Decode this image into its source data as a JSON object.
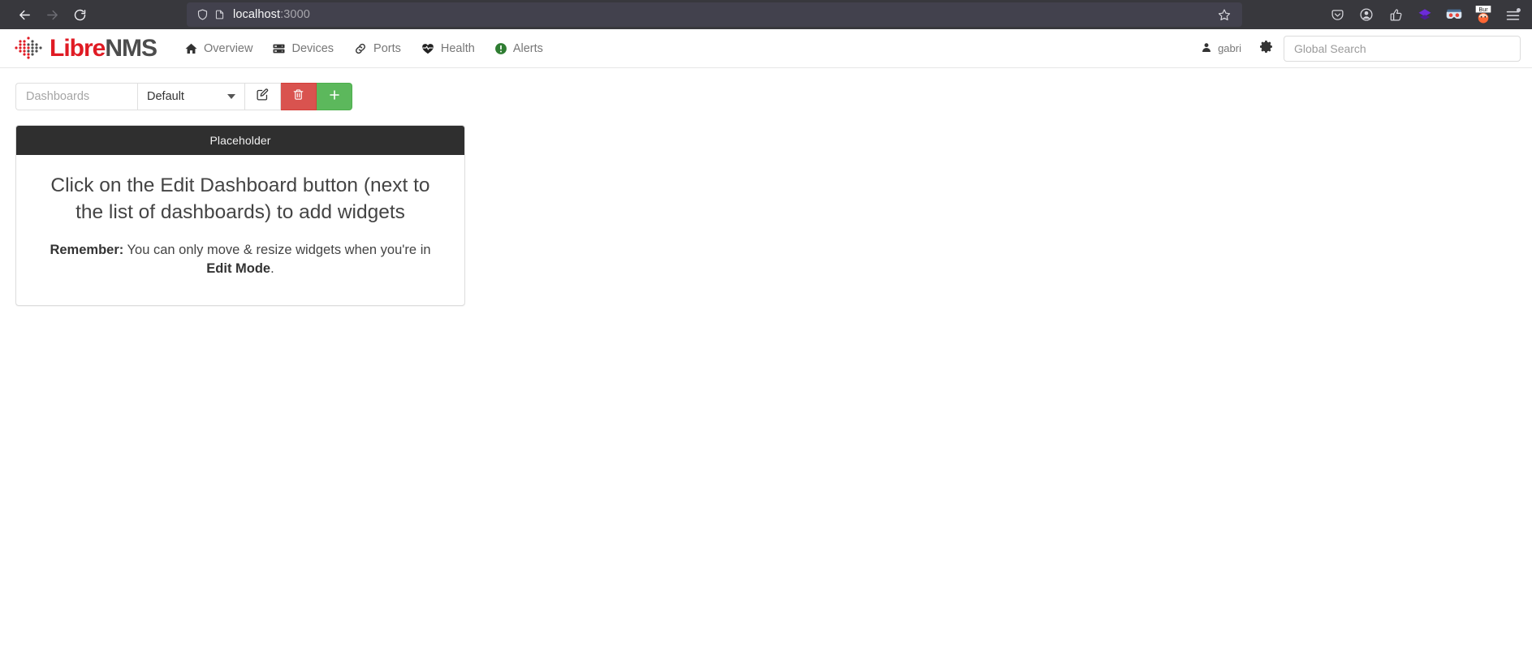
{
  "browser": {
    "back_icon": "back-arrow-icon",
    "forward_icon": "forward-arrow-icon",
    "reload_icon": "reload-icon",
    "shield_icon": "shield-icon",
    "page_icon": "page-info-icon",
    "url_host": "localhost",
    "url_port": ":3000",
    "url_full": "localhost:3000",
    "star_icon": "bookmark-star-icon",
    "extensions": [
      {
        "name": "pocket-icon",
        "glyph": "pocket"
      },
      {
        "name": "account-icon",
        "glyph": "account"
      },
      {
        "name": "thumb-extension-icon",
        "glyph": "thumb"
      },
      {
        "name": "layers-extension-icon",
        "glyph": "layers"
      },
      {
        "name": "goggles-extension-icon",
        "glyph": "goggles"
      },
      {
        "name": "burp-extension-icon",
        "glyph": "Bur"
      },
      {
        "name": "app-menu-icon",
        "glyph": "menu"
      }
    ]
  },
  "navbar": {
    "brand": {
      "red_part": "Libre",
      "dark_part": "NMS",
      "logo_icon": "librenms-logo-icon"
    },
    "items": [
      {
        "label": "Overview",
        "icon": "home-icon"
      },
      {
        "label": "Devices",
        "icon": "server-icon"
      },
      {
        "label": "Ports",
        "icon": "link-icon"
      },
      {
        "label": "Health",
        "icon": "heartbeat-icon"
      },
      {
        "label": "Alerts",
        "icon": "alert-circle-icon"
      }
    ],
    "user": {
      "name": "gabri",
      "icon": "user-icon"
    },
    "settings_icon": "gear-icon",
    "search": {
      "placeholder": "Global Search",
      "value": ""
    }
  },
  "toolbar": {
    "dashboards_label": "Dashboards",
    "dashboard_select": {
      "value": "Default",
      "options": [
        "Default"
      ]
    },
    "edit_button": {
      "label": "",
      "icon": "edit-pencil-square-icon",
      "title": "Edit Dashboard"
    },
    "delete_button": {
      "label": "",
      "icon": "trash-icon",
      "title": "Delete Dashboard"
    },
    "add_button": {
      "label": "",
      "icon": "plus-icon",
      "title": "Add Dashboard"
    }
  },
  "widget": {
    "title": "Placeholder",
    "lead": "Click on the Edit Dashboard button (next to the list of dashboards) to add widgets",
    "remember_label": "Remember:",
    "remember_text_1": " You can only move & resize widgets when you're in ",
    "remember_bold": "Edit Mode",
    "remember_text_2": "."
  },
  "colors": {
    "brand_red": "#e01b24",
    "brand_dark": "#4d4d4d",
    "danger": "#d9534f",
    "success": "#5cb85c",
    "widget_header_bg": "#2f2f2f",
    "chrome_bg": "#38383d",
    "urlbar_bg": "#42414d"
  }
}
